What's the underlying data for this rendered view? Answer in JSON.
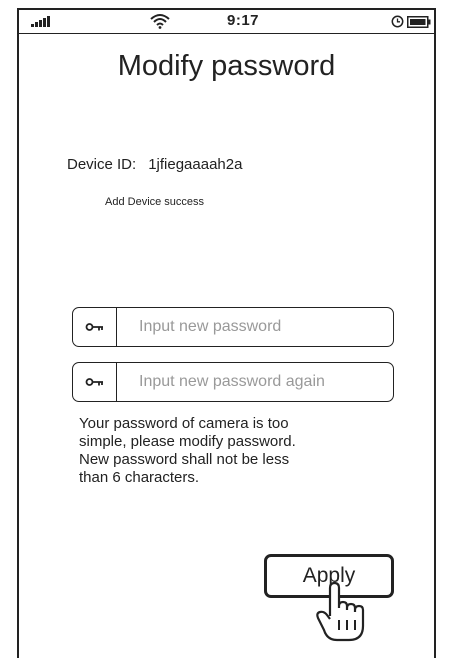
{
  "status_bar": {
    "time": "9:17",
    "icons": [
      "signal-icon",
      "wifi-icon",
      "alarm-icon",
      "battery-icon"
    ]
  },
  "title": "Modify password",
  "device": {
    "label": "Device ID:",
    "value": "1jfiegaaaah2a"
  },
  "success_message": "Add Device success",
  "fields": {
    "new_password": {
      "placeholder": "Input new password",
      "value": "",
      "icon": "key-icon"
    },
    "confirm_password": {
      "placeholder": "Input new password again",
      "value": "",
      "icon": "key-icon"
    }
  },
  "hint": {
    "lines": [
      "Your password of camera is too",
      "simple, please modify password.",
      "New password shall not be less",
      "than 6 characters."
    ]
  },
  "apply_label": "Apply"
}
